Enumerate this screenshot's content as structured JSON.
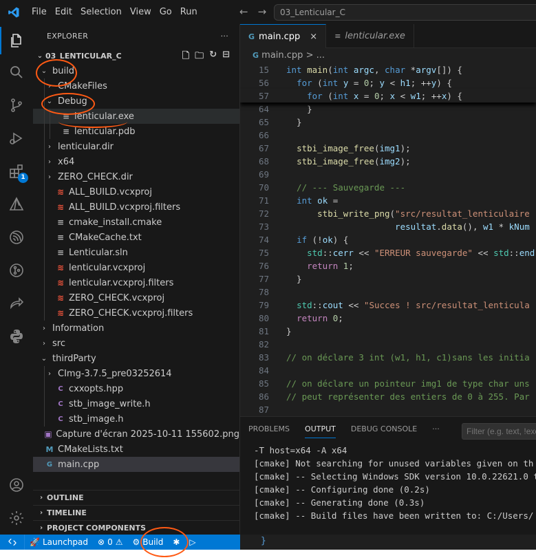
{
  "titlebar": {
    "menus": [
      "File",
      "Edit",
      "Selection",
      "View",
      "Go",
      "Run"
    ],
    "search_text": "03_Lenticular_C"
  },
  "sidebar": {
    "header": "EXPLORER",
    "more": "···",
    "root": "03_LENTICULAR_C",
    "tree": [
      {
        "label": "build",
        "kind": "folder-open",
        "depth": 0
      },
      {
        "label": "CMakeFiles",
        "kind": "folder",
        "depth": 1
      },
      {
        "label": "Debug",
        "kind": "folder-open",
        "depth": 1
      },
      {
        "label": "lenticular.exe",
        "kind": "lines",
        "depth": 2,
        "selected": true
      },
      {
        "label": "lenticular.pdb",
        "kind": "lines",
        "depth": 2
      },
      {
        "label": "lenticular.dir",
        "kind": "folder",
        "depth": 1
      },
      {
        "label": "x64",
        "kind": "folder",
        "depth": 1
      },
      {
        "label": "ZERO_CHECK.dir",
        "kind": "folder",
        "depth": 1
      },
      {
        "label": "ALL_BUILD.vcxproj",
        "kind": "xml",
        "depth": 1
      },
      {
        "label": "ALL_BUILD.vcxproj.filters",
        "kind": "xml",
        "depth": 1
      },
      {
        "label": "cmake_install.cmake",
        "kind": "lines",
        "depth": 1
      },
      {
        "label": "CMakeCache.txt",
        "kind": "lines",
        "depth": 1
      },
      {
        "label": "Lenticular.sln",
        "kind": "lines",
        "depth": 1
      },
      {
        "label": "lenticular.vcxproj",
        "kind": "xml",
        "depth": 1
      },
      {
        "label": "lenticular.vcxproj.filters",
        "kind": "xml",
        "depth": 1
      },
      {
        "label": "ZERO_CHECK.vcxproj",
        "kind": "xml",
        "depth": 1
      },
      {
        "label": "ZERO_CHECK.vcxproj.filters",
        "kind": "xml",
        "depth": 1
      },
      {
        "label": "Information",
        "kind": "folder",
        "depth": 0
      },
      {
        "label": "src",
        "kind": "folder",
        "depth": 0
      },
      {
        "label": "thirdParty",
        "kind": "folder-open",
        "depth": 0
      },
      {
        "label": "CImg-3.7.5_pre03252614",
        "kind": "folder",
        "depth": 1
      },
      {
        "label": "cxxopts.hpp",
        "kind": "c",
        "depth": 1
      },
      {
        "label": "stb_image_write.h",
        "kind": "c",
        "depth": 1
      },
      {
        "label": "stb_image.h",
        "kind": "c",
        "depth": 1
      },
      {
        "label": "Capture d'écran 2025-10-11 155602.png",
        "kind": "img",
        "depth": 0
      },
      {
        "label": "CMakeLists.txt",
        "kind": "cmake",
        "depth": 0
      },
      {
        "label": "main.cpp",
        "kind": "cpp",
        "depth": 0,
        "active": true
      }
    ],
    "sections": [
      "OUTLINE",
      "TIMELINE",
      "PROJECT COMPONENTS"
    ]
  },
  "editor": {
    "tabs": [
      {
        "label": "main.cpp",
        "icon": "G",
        "active": true,
        "close": "×"
      },
      {
        "label": "lenticular.exe",
        "icon": "≡",
        "active": false
      }
    ],
    "breadcrumb": "main.cpp > ...",
    "lines": [
      {
        "n": "15",
        "t": "int main(int argc, char *argv[]) {"
      },
      {
        "n": "56",
        "t": "  for (int y = 0; y < h1; ++y) {"
      },
      {
        "n": "57",
        "t": "    for (int x = 0; x < w1; ++x) {"
      },
      {
        "n": "64",
        "t": "    }"
      },
      {
        "n": "65",
        "t": "  }"
      },
      {
        "n": "66",
        "t": ""
      },
      {
        "n": "67",
        "t": "  stbi_image_free(img1);"
      },
      {
        "n": "68",
        "t": "  stbi_image_free(img2);"
      },
      {
        "n": "69",
        "t": ""
      },
      {
        "n": "70",
        "t": "  // --- Sauvegarde ---"
      },
      {
        "n": "71",
        "t": "  int ok ="
      },
      {
        "n": "72",
        "t": "      stbi_write_png(\"src/resultat_lenticulaire"
      },
      {
        "n": "73",
        "t": "                     resultat.data(), w1 * kNum"
      },
      {
        "n": "74",
        "t": "  if (!ok) {"
      },
      {
        "n": "75",
        "t": "    std::cerr << \"ERREUR sauvegarde\" << std::end"
      },
      {
        "n": "76",
        "t": "    return 1;"
      },
      {
        "n": "77",
        "t": "  }"
      },
      {
        "n": "78",
        "t": ""
      },
      {
        "n": "79",
        "t": "  std::cout << \"Succes ! src/resultat_lenticula"
      },
      {
        "n": "80",
        "t": "  return 0;"
      },
      {
        "n": "81",
        "t": "}"
      },
      {
        "n": "82",
        "t": ""
      },
      {
        "n": "83",
        "t": "// on déclare 3 int (w1, h1, c1)sans les initia"
      },
      {
        "n": "84",
        "t": ""
      },
      {
        "n": "85",
        "t": "// on déclare un pointeur img1 de type char uns"
      },
      {
        "n": "86",
        "t": "// peut représenter des entiers de 0 à 255. Par"
      },
      {
        "n": "87",
        "t": ""
      },
      {
        "n": "88",
        "t": "// on assigne img1 à une fonction qui retourne"
      }
    ]
  },
  "panel": {
    "tabs": [
      "PROBLEMS",
      "OUTPUT",
      "DEBUG CONSOLE"
    ],
    "active_tab": "OUTPUT",
    "more": "···",
    "filter_placeholder": "Filter (e.g. text, !exc",
    "lines": [
      "-T host=x64 -A x64",
      "[cmake] Not searching for unused variables given on th",
      "[cmake] -- Selecting Windows SDK version 10.0.22621.0 t",
      "[cmake] -- Configuring done (0.2s)",
      "[cmake] -- Generating done (0.3s)",
      "[cmake] -- Build files have been written to: C:/Users/"
    ]
  },
  "statusbar": {
    "launchpad": "Launchpad",
    "errors": "0",
    "warnings": "0",
    "build": "Build"
  },
  "colors": {
    "accent": "#0078d4",
    "annotation": "#ff5a14"
  }
}
